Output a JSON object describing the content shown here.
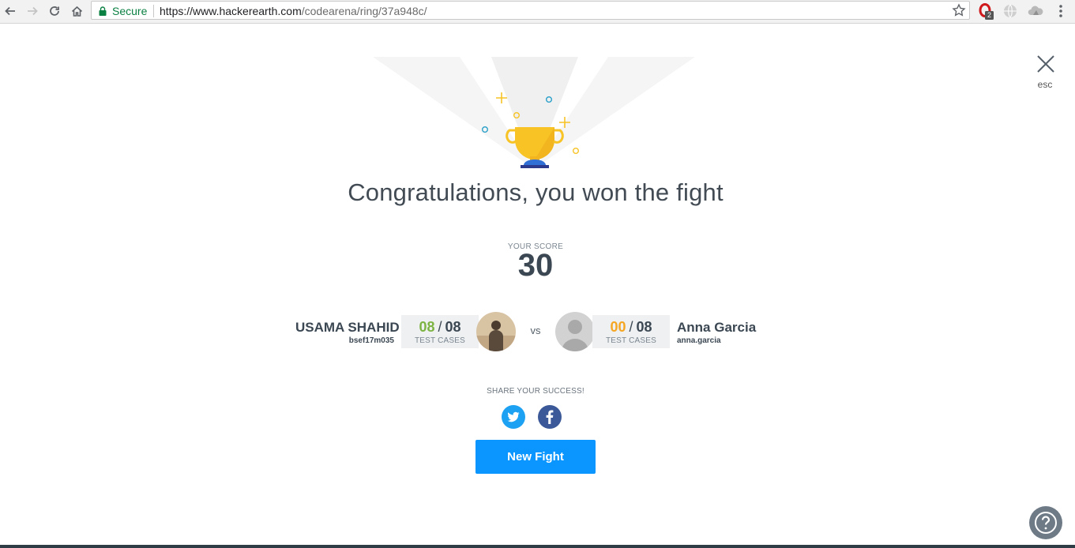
{
  "browser": {
    "secure_label": "Secure",
    "url_host": "https://www.hackerearth.com",
    "url_path": "/codearena/ring/37a948c/",
    "extension_badge": "2",
    "icons": {
      "back": "back-arrow-icon",
      "forward": "forward-arrow-icon",
      "reload": "reload-icon",
      "home": "home-icon",
      "lock": "lock-icon",
      "star": "star-icon",
      "menu": "kebab-menu-icon"
    }
  },
  "page": {
    "close_label": "esc",
    "headline": "Congratulations, you won the fight",
    "score_label": "YOUR SCORE",
    "score_value": "30",
    "vs_label": "vs",
    "share_label": "SHARE YOUR SUCCESS!",
    "new_fight_label": "New Fight",
    "colors": {
      "accent": "#0a95ff",
      "text": "#3b4752",
      "pass_green": "#7cb342",
      "fail_orange": "#f5a623",
      "twitter": "#1da1f2",
      "facebook": "#3b5998",
      "trophy_gold": "#f7c325",
      "trophy_base": "#2f6fd6"
    }
  },
  "players": [
    {
      "name": "USAMA SHAHID",
      "handle": "bsef17m035",
      "passed": "08",
      "total": "08",
      "cases_label": "TEST CASES"
    },
    {
      "name": "Anna Garcia",
      "handle": "anna.garcia",
      "passed": "00",
      "total": "08",
      "cases_label": "TEST CASES"
    }
  ]
}
